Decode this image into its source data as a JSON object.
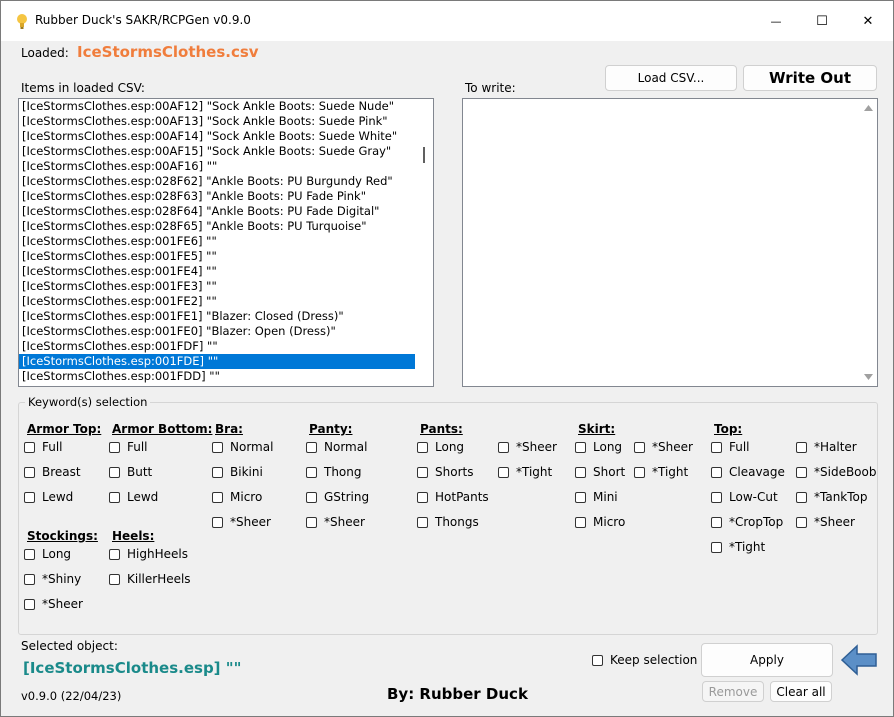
{
  "window": {
    "title": "Rubber Duck's SAKR/RCPGen v0.9.0",
    "minimize_glyph": "—",
    "maximize_glyph": "☐",
    "close_glyph": "✕"
  },
  "loaded": {
    "label": "Loaded:",
    "filename": "IceStormsClothes.csv",
    "filename_color": "#f07d3c"
  },
  "items_panel": {
    "label": "Items in loaded CSV:",
    "items": [
      "[IceStormsClothes.esp:00AF12] \"Sock Ankle Boots: Suede Nude\"",
      "[IceStormsClothes.esp:00AF13] \"Sock Ankle Boots: Suede Pink\"",
      "[IceStormsClothes.esp:00AF14] \"Sock Ankle Boots: Suede White\"",
      "[IceStormsClothes.esp:00AF15] \"Sock Ankle Boots: Suede Gray\"",
      "[IceStormsClothes.esp:00AF16] \"\"",
      "[IceStormsClothes.esp:028F62] \"Ankle Boots: PU Burgundy Red\"",
      "[IceStormsClothes.esp:028F63] \"Ankle Boots: PU Fade Pink\"",
      "[IceStormsClothes.esp:028F64] \"Ankle Boots: PU Fade Digital\"",
      "[IceStormsClothes.esp:028F65] \"Ankle Boots: PU Turquoise\"",
      "[IceStormsClothes.esp:001FE6] \"\"",
      "[IceStormsClothes.esp:001FE5] \"\"",
      "[IceStormsClothes.esp:001FE4] \"\"",
      "[IceStormsClothes.esp:001FE3] \"\"",
      "[IceStormsClothes.esp:001FE2] \"\"",
      "[IceStormsClothes.esp:001FE1] \"Blazer: Closed (Dress)\"",
      "[IceStormsClothes.esp:001FE0] \"Blazer: Open (Dress)\"",
      "[IceStormsClothes.esp:001FDF] \"\"",
      "[IceStormsClothes.esp:001FDE] \"\"",
      "[IceStormsClothes.esp:001FDD] \"\""
    ],
    "selected_index": 17
  },
  "write_panel": {
    "label": "To write:",
    "load_csv_button": "Load CSV...",
    "write_out_button": "Write Out"
  },
  "keywords": {
    "group_label": "Keyword(s) selection",
    "armor_top": {
      "title": "Armor Top:",
      "options": [
        "Full",
        "Breast",
        "Lewd"
      ]
    },
    "armor_bottom": {
      "title": "Armor Bottom:",
      "options": [
        "Full",
        "Butt",
        "Lewd"
      ]
    },
    "bra": {
      "title": "Bra:",
      "options": [
        "Normal",
        "Bikini",
        "Micro",
        "*Sheer"
      ]
    },
    "panty": {
      "title": "Panty:",
      "options": [
        "Normal",
        "Thong",
        "GString",
        "*Sheer"
      ]
    },
    "pants": {
      "title": "Pants:",
      "options": [
        "Long",
        "Shorts",
        "HotPants",
        "Thongs"
      ],
      "extra": [
        "*Sheer",
        "*Tight"
      ]
    },
    "skirt": {
      "title": "Skirt:",
      "options": [
        "Long",
        "Short",
        "Mini",
        "Micro"
      ],
      "extra": [
        "*Sheer",
        "*Tight"
      ]
    },
    "top": {
      "title": "Top:",
      "options": [
        "Full",
        "Cleavage",
        "Low-Cut",
        "*CropTop",
        "*Tight"
      ],
      "extra": [
        "*Halter",
        "*SideBoob",
        "*TankTop",
        "*Sheer"
      ]
    },
    "stockings": {
      "title": "Stockings:",
      "options": [
        "Long",
        "*Shiny",
        "*Sheer"
      ]
    },
    "heels": {
      "title": "Heels:",
      "options": [
        "HighHeels",
        "KillerHeels"
      ]
    }
  },
  "selected": {
    "label": "Selected object:",
    "value": "[IceStormsClothes.esp] \"\"",
    "value_color": "#1a8a8a"
  },
  "footer": {
    "keep_selection": "Keep selection",
    "apply": "Apply",
    "remove": "Remove",
    "clear_all": "Clear all",
    "version": "v0.9.0 (22/04/23)",
    "author": "By: Rubber Duck"
  }
}
